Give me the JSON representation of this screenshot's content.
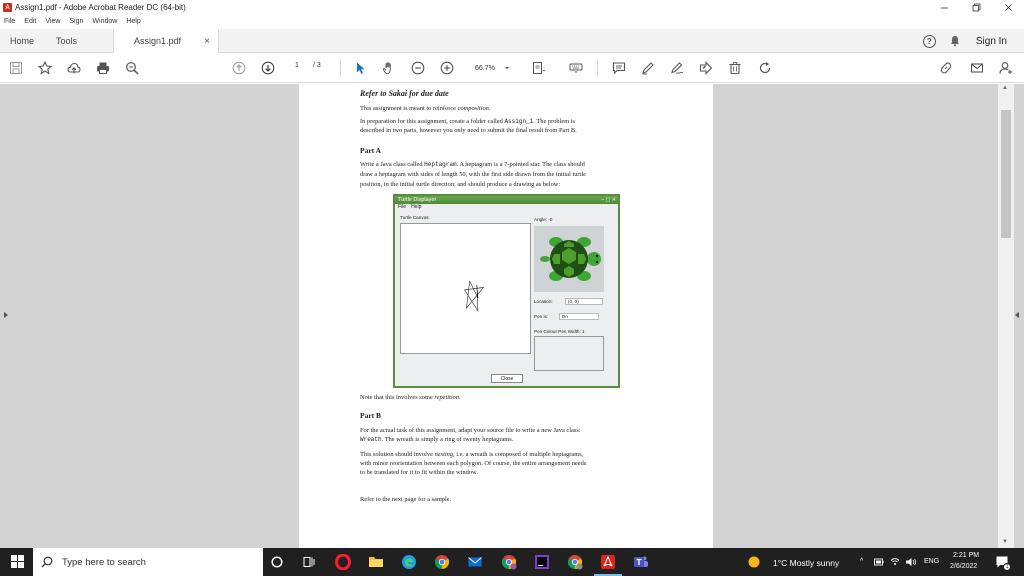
{
  "window": {
    "title": "Assign1.pdf - Adobe Acrobat Reader DC (64-bit)",
    "app_icon_glyph": "A"
  },
  "menu": [
    "File",
    "Edit",
    "View",
    "Sign",
    "Window",
    "Help"
  ],
  "tabs": {
    "home": "Home",
    "tools": "Tools",
    "document": "Assign1.pdf",
    "close_glyph": "×"
  },
  "header_right": {
    "help_glyph": "?",
    "sign_in": "Sign In"
  },
  "toolbar": {
    "current_page": "1",
    "total_pages": "/ 3",
    "zoom": "66.7%"
  },
  "document": {
    "heading": "Refer to Sakai for due date",
    "intro": "This assignment is meant to reinforce",
    "intro_italic": "composition.",
    "prep_1": "In preparation for this assignment, create a folder called",
    "prep_code": "Assign_1",
    "prep_2": ". The problem is",
    "prep_3": "described in two parts, however you only need to submit the final result from Part B.",
    "part_a_title": "Part A",
    "part_a_1a": "Write a Java class called",
    "part_a_1code": "Heptagram",
    "part_a_1b": ". A heptagram is a 7-pointed star. The class should",
    "part_a_2": "draw a heptagram with sides of length 50, with the first side drawn from the initial turtle",
    "part_a_3": "position, in the initial turtle direction, and should produce a drawing as below:",
    "turtle_window": {
      "title": "Turtle Displayer",
      "window_controls": "– ▢ ✕",
      "menu": [
        "File",
        "Help"
      ],
      "canvas_label": "Turtle Canvas:",
      "angle_label": "Angle: -0",
      "location_label": "Location:",
      "location_value": "(0, 0)",
      "pen_label": "Pen is:",
      "pen_value": "Dn",
      "pen_colour_label": "Pen Colour:Pen Width: 1",
      "close_button": "Close"
    },
    "note_1": "Note that this involves some",
    "note_italic": "repetition.",
    "part_b_title": "Part B",
    "part_b_1": "For the actual task of this assignment, adapt your source file to write a new Java class:",
    "part_b_code": "Wreath",
    "part_b_2": ". The wreath is simply a ring of twenty heptagrams.",
    "part_b_3a": "This solution should involve",
    "part_b_3italic": "nesting,",
    "part_b_3b": "i.e. a wreath is composed of multiple heptagrams,",
    "part_b_4": "with minor reorientation between each polygon. Of course, the entire arrangement needs",
    "part_b_5": "to be translated for it to fit within the window.",
    "next_page": "Refer to the next page for a sample."
  },
  "taskbar": {
    "search_placeholder": "Type here to search",
    "weather": "1°C  Mostly sunny",
    "language": "ENG",
    "time": "2:21 PM",
    "date": "2/6/2022",
    "notification_count": "1"
  },
  "colors": {
    "acrobat_red": "#d9271d",
    "toolbar_icon": "#555555",
    "doc_background": "#d3d3d3",
    "taskbar": "#202020",
    "turtle_green": "#5a8c3e"
  }
}
